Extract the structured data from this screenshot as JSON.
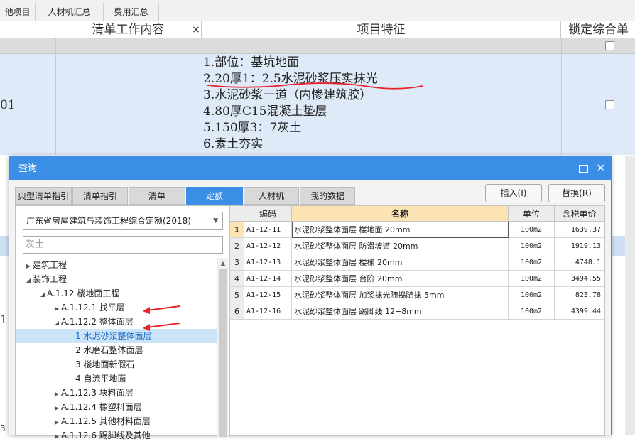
{
  "top_tabs": [
    "他项目",
    "人材机汇总",
    "费用汇总"
  ],
  "header": {
    "col_work": "清单工作内容",
    "col_features": "项目特征",
    "col_lock": "锁定综合单",
    "close": "×"
  },
  "row": {
    "code_fragment": "01",
    "features": [
      "1.部位：基坑地面",
      "2.20厚1：2.5水泥砂浆压实抹光",
      "3.水泥砂浆一道（内惨建筑胶）",
      "4.80厚C15混凝土垫层",
      "5.150厚3：7灰土",
      "6.素土夯实"
    ]
  },
  "dialog": {
    "title": "查询",
    "tabs": [
      "典型清单指引",
      "清单指引",
      "清单",
      "定额",
      "人材机",
      "我的数据"
    ],
    "active_tab": "定额",
    "insert_button": "插入(I)",
    "replace_button": "替换(R)",
    "quota_library": "广东省房屋建筑与装饰工程综合定额(2018)",
    "search_value": "灰土",
    "tree": [
      {
        "label": "建筑工程",
        "level": 0,
        "arrow": "right"
      },
      {
        "label": "装饰工程",
        "level": 0,
        "arrow": "down"
      },
      {
        "label": "A.1.12 楼地面工程",
        "level": 1,
        "arrow": "down"
      },
      {
        "label": "A.1.12.1 找平层",
        "level": 2,
        "arrow": "right"
      },
      {
        "label": "A.1.12.2 整体面层",
        "level": 2,
        "arrow": "down"
      },
      {
        "label": "1 水泥砂浆整体面层",
        "level": 3,
        "arrow": "",
        "selected": true
      },
      {
        "label": "2 水磨石整体面层",
        "level": 3,
        "arrow": ""
      },
      {
        "label": "3 楼地面新假石",
        "level": 3,
        "arrow": ""
      },
      {
        "label": "4 自流平地面",
        "level": 3,
        "arrow": ""
      },
      {
        "label": "A.1.12.3 块料面层",
        "level": 2,
        "arrow": "right"
      },
      {
        "label": "A.1.12.4 橡塑料面层",
        "level": 2,
        "arrow": "right"
      },
      {
        "label": "A.1.12.5 其他材料面层",
        "level": 2,
        "arrow": "right"
      },
      {
        "label": "A.1.12.6 踢脚线及其他",
        "level": 2,
        "arrow": "right"
      }
    ],
    "grid": {
      "headers": {
        "code": "编码",
        "name": "名称",
        "unit": "单位",
        "price": "含税单价"
      },
      "rows": [
        {
          "num": "1",
          "code": "A1-12-11",
          "name": "水泥砂浆整体面层 楼地面 20mm",
          "unit": "100m2",
          "price": "1639.37"
        },
        {
          "num": "2",
          "code": "A1-12-12",
          "name": "水泥砂浆整体面层 防滑坡道 20mm",
          "unit": "100m2",
          "price": "1919.13"
        },
        {
          "num": "3",
          "code": "A1-12-13",
          "name": "水泥砂浆整体面层 楼梯 20mm",
          "unit": "100m2",
          "price": "4748.1"
        },
        {
          "num": "4",
          "code": "A1-12-14",
          "name": "水泥砂浆整体面层 台阶 20mm",
          "unit": "100m2",
          "price": "3494.55"
        },
        {
          "num": "5",
          "code": "A1-12-15",
          "name": "水泥砂浆整体面层 加浆抹光随捣随抹 5mm",
          "unit": "100m2",
          "price": "823.78"
        },
        {
          "num": "6",
          "code": "A1-12-16",
          "name": "水泥砂浆整体面层 踢脚线 12+8mm",
          "unit": "100m2",
          "price": "4399.44"
        }
      ]
    }
  },
  "colors": {
    "accent": "#3a8ee6",
    "selected_row": "#cce4f7",
    "header_highlight": "#fbe3b4",
    "annotation": "#e8232a"
  }
}
